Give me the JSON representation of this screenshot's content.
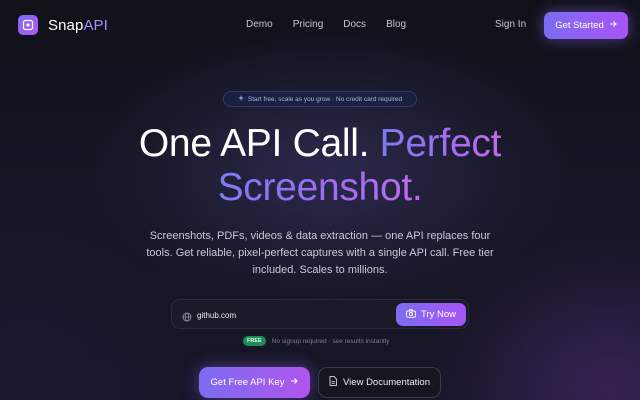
{
  "nav": {
    "logo_word_1": "Snap",
    "logo_word_2": "API",
    "links": [
      "Demo",
      "Pricing",
      "Docs",
      "Blog"
    ],
    "sign_in": "Sign In",
    "get_started": "Get Started"
  },
  "hero": {
    "badge": "Start free, scale as you grow · No credit card required",
    "headline_part1": "One API Call.",
    "headline_part2": "Perfect",
    "headline_line2": "Screenshot.",
    "subtitle": "Screenshots, PDFs, videos & data extraction — one API replaces four tools. Get reliable, pixel-perfect captures with a single API call. Free tier included. Scales to millions."
  },
  "try_form": {
    "input_value": "github.com",
    "button_label": "Try Now",
    "free_badge": "FREE",
    "note": "No signup required · see results instantly"
  },
  "cta": {
    "api_key": "Get Free API Key",
    "docs": "View Documentation"
  },
  "colors": {
    "background": "#141420",
    "accent_start": "#7c6cf0",
    "accent_end": "#a855f7",
    "free_green": "#1f8a57"
  },
  "icons": [
    "logo-mark-icon",
    "arrow-right-icon",
    "sparkle-icon",
    "globe-icon",
    "camera-icon",
    "document-icon"
  ]
}
